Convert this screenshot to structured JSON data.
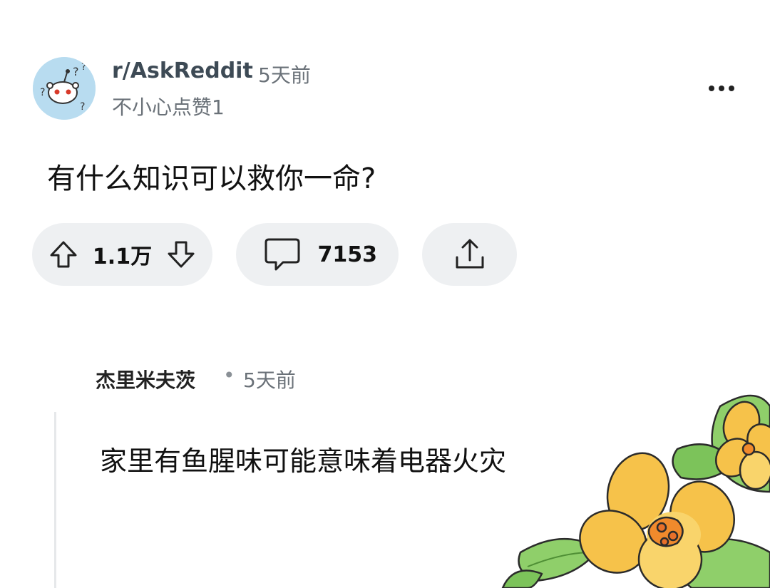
{
  "post": {
    "subreddit": "r/AskReddit",
    "time": "5天前",
    "author": "不小心点赞1",
    "title": "有什么知识可以救你一命?",
    "score": "1.1万",
    "comment_count": "7153"
  },
  "comment": {
    "author": "杰里米夫茨",
    "separator": "•",
    "time": "5天前",
    "body": "家里有鱼腥味可能意味着电器火灾"
  },
  "colors": {
    "pill_bg": "#eef0f2",
    "avatar_bg": "#b8dcf0",
    "flower_petal": "#f6c24a",
    "leaf": "#7cc35a"
  },
  "icons": {
    "avatar": "reddit-snoo-question-icon",
    "more": "more-horizontal-icon",
    "upvote": "arrow-up-icon",
    "downvote": "arrow-down-icon",
    "comments": "speech-bubble-icon",
    "share": "share-icon",
    "decoration": "osmanthus-flower-illustration"
  }
}
